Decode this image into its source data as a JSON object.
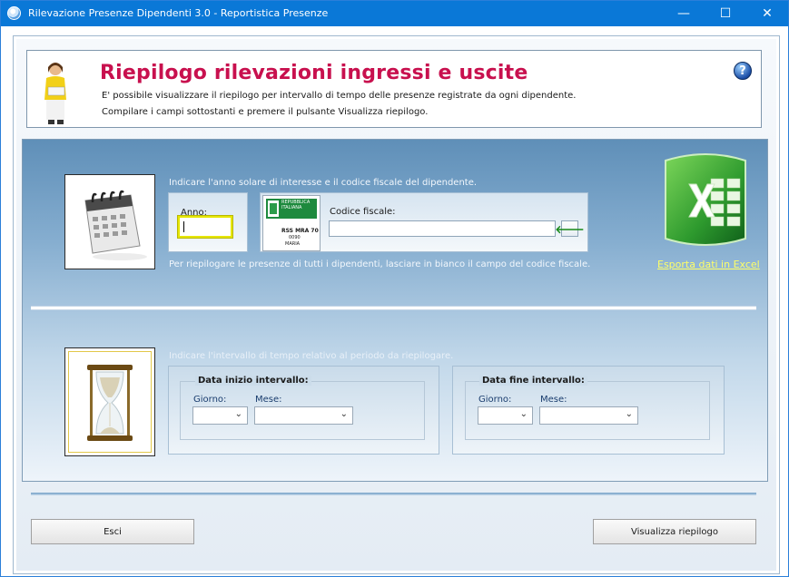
{
  "window": {
    "title": "Rilevazione Presenze Dipendenti 3.0 - Reportistica Presenze",
    "controls": {
      "minimize": "—",
      "maximize": "☐",
      "close": "✕"
    }
  },
  "header": {
    "title": "Riepilogo rilevazioni ingressi e uscite",
    "line1": "E' possibile visualizzare il riepilogo per intervallo di tempo delle presenze registrate da ogni dipendente.",
    "line2": "Compilare i campi sottostanti e premere il pulsante Visualizza riepilogo.",
    "help": "?"
  },
  "section1": {
    "hint_top": "Indicare l'anno solare di interesse e il codice fiscale del dipendente.",
    "anno_label": "Anno:",
    "anno_value": "",
    "codice_label": "Codice fiscale:",
    "codice_value": "",
    "go_symbol": "🡐",
    "hint_bottom": "Per riepilogare le presenze di tutti i dipendenti, lasciare in bianco il campo del codice fiscale.",
    "card": {
      "l1": "REPUBBLICA ITALIANA",
      "l2": "RSS MRA 70",
      "l3": "0090",
      "l4": "MARIA"
    },
    "export_link": "Esporta dati in Excel"
  },
  "section2": {
    "hint": "Indicare l'intervallo di tempo relativo al periodo da riepilogare.",
    "start": {
      "title": "Data inizio intervallo:",
      "giorno_label": "Giorno:",
      "mese_label": "Mese:",
      "giorno": "",
      "mese": ""
    },
    "end": {
      "title": "Data fine intervallo:",
      "giorno_label": "Giorno:",
      "mese_label": "Mese:",
      "giorno": "",
      "mese": ""
    },
    "chevron": "⌄"
  },
  "buttons": {
    "exit": "Esci",
    "view": "Visualizza riepilogo"
  },
  "colors": {
    "title_bar": "#0a78d7",
    "header_title": "#c8104e",
    "link": "#ffff66"
  }
}
